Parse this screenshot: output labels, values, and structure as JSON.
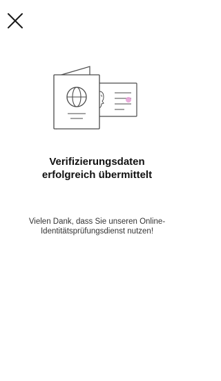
{
  "header": {
    "close_icon": "close-x-icon"
  },
  "illustration": {
    "icon": "passport-and-id-card-icon",
    "accent_color": "#e8a3d8",
    "line_color": "#4a4a4a"
  },
  "content": {
    "title_line1": "Verifizierungsdaten",
    "title_line2": "erfolgreich übermittelt",
    "message_line1": "Vielen Dank, dass Sie unseren Online-",
    "message_line2": "Identitätsprüfungsdienst nutzen!"
  }
}
